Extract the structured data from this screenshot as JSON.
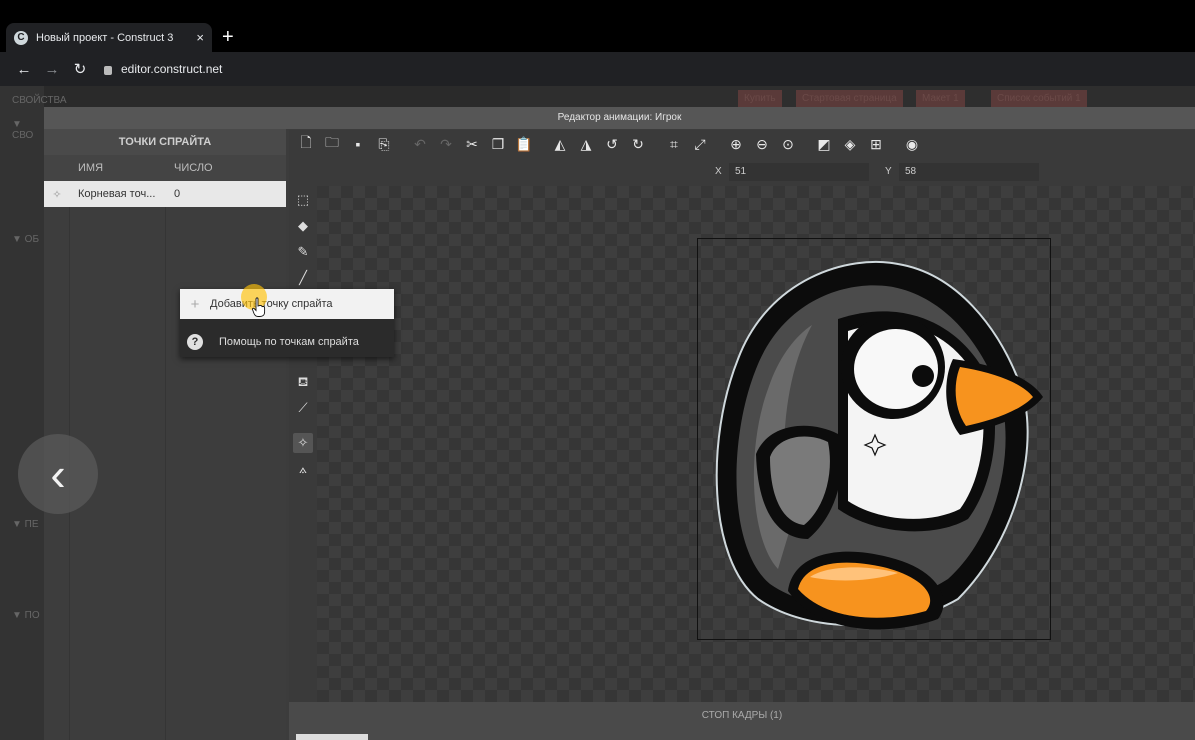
{
  "browser": {
    "tab_title": "Новый проект - Construct 3",
    "tab_close": "×",
    "new_tab": "+",
    "url": "editor.construct.net",
    "favicon": "C"
  },
  "underlying_editor": {
    "left_labels": [
      "СВОЙСТВА",
      "▼ СВО",
      "▼ ОБ",
      "▼ ПЕ",
      "▼ ПО"
    ],
    "top_tabs": [
      "Купить",
      "Стартовая страница",
      "Макет 1",
      "Список событий 1"
    ]
  },
  "dialog": {
    "title": "Редактор анимации: Игрок"
  },
  "points_panel": {
    "header": "ТОЧКИ СПРАЙТА",
    "columns": [
      "ИМЯ",
      "ЧИСЛО"
    ],
    "rows": [
      {
        "name": "Корневая точ...",
        "number": "0"
      }
    ]
  },
  "context_menu": {
    "items": [
      {
        "label": "Добавить точку спрайта",
        "icon": "plus-icon"
      },
      {
        "label": "Помощь по точкам спрайта",
        "icon": "help-icon"
      }
    ]
  },
  "coords": {
    "x_label": "X",
    "x_value": "51",
    "y_label": "Y",
    "y_value": "58"
  },
  "frames_panel": {
    "title": "СТОП КАДРЫ (1)"
  },
  "icons": {
    "back": "chevron-left-icon"
  }
}
